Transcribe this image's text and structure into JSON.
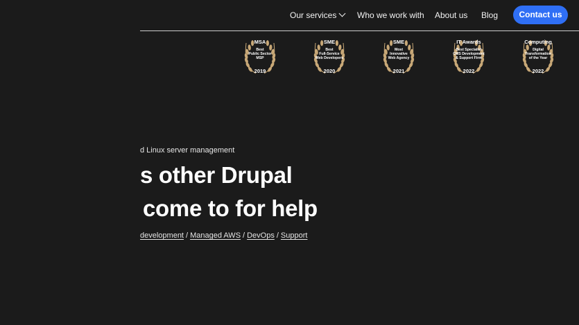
{
  "nav": {
    "services_label": "Our services",
    "who_label": "Who we work with",
    "about_label": "About us",
    "blog_label": "Blog",
    "contact_label": "Contact us"
  },
  "colors": {
    "background": "#1b1b1b",
    "accent": "#2f6ff5",
    "laurel": "#c8a877"
  },
  "awards": [
    {
      "title": "MSA",
      "desc1": "Best",
      "desc2": "Public Sector",
      "desc3": "MSP",
      "desc4": "",
      "year": "2019"
    },
    {
      "title": "SME",
      "desc1": "Best",
      "desc2": "Full-Service",
      "desc3": "Web Developers",
      "desc4": "",
      "year": "2020"
    },
    {
      "title": "SME",
      "desc1": "Most",
      "desc2": "Innovative",
      "desc3": "Web Agency",
      "desc4": "",
      "year": "2021"
    },
    {
      "title": "IT Awards",
      "desc1": "Best Specialist",
      "desc2": "CMS Development",
      "desc3": "& Support Firm",
      "desc4": "",
      "year": "2022"
    },
    {
      "title": "Computing",
      "desc1": "Digital",
      "desc2": "Transformation",
      "desc3": "of the Year",
      "desc4": "",
      "year": "2022"
    }
  ],
  "hero": {
    "tagline": "d Linux server management",
    "headline_1": "s other Drupal",
    "headline_2": "come to for help",
    "links": [
      "development",
      "Managed AWS",
      "DevOps",
      "Support"
    ],
    "separator": "/"
  }
}
